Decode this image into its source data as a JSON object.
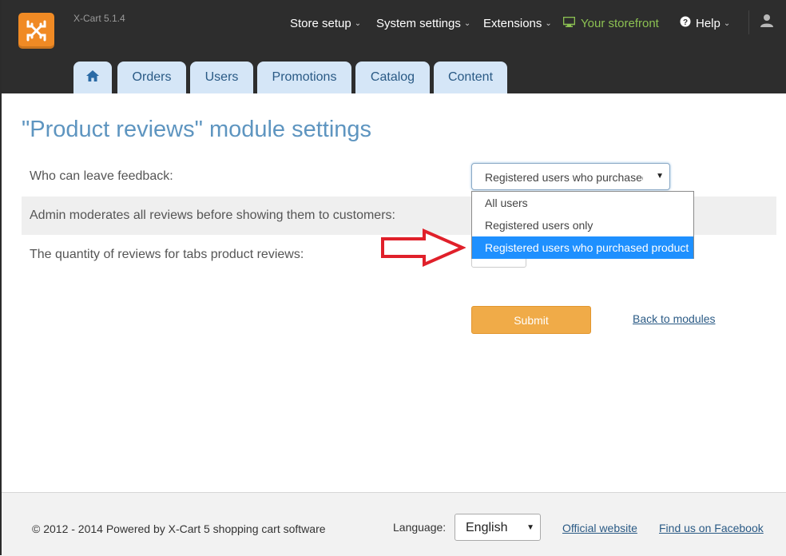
{
  "app": {
    "version": "X-Cart 5.1.4",
    "logo": "x-cart-logo"
  },
  "topnav": {
    "store_setup": "Store setup",
    "system_settings": "System settings",
    "extensions": "Extensions",
    "storefront": "Your storefront",
    "help": "Help"
  },
  "tabs": [
    "Orders",
    "Users",
    "Promotions",
    "Catalog",
    "Content"
  ],
  "page": {
    "title": "\"Product reviews\" module settings",
    "settings": [
      {
        "label": "Who can leave feedback:",
        "value": "Registered users who purchased product"
      },
      {
        "label": "Admin moderates all reviews before showing them to customers:"
      },
      {
        "label": "The quantity of reviews for tabs product reviews:"
      }
    ],
    "dropdown_options": [
      "All users",
      "Registered users only",
      "Registered users who purchased product"
    ],
    "selected_option_index": 2,
    "submit_label": "Submit",
    "back_link": "Back to modules"
  },
  "footer": {
    "copyright": "© 2012 - 2014 Powered by X-Cart 5 shopping cart software",
    "language_label": "Language:",
    "language_value": "English",
    "official_website": "Official website",
    "facebook": "Find us on Facebook"
  },
  "colors": {
    "header_bg": "#2d2d2d",
    "tab_bg": "#d5e6f7",
    "title": "#5e95c0",
    "storefront": "#8cc152",
    "submit": "#f0ab48",
    "selected_option": "#1e90ff",
    "arrow": "#e0202a"
  },
  "icons": [
    "home-icon",
    "monitor-icon",
    "help-circle-icon",
    "user-icon",
    "chevron-down-icon",
    "red-outline-arrow"
  ]
}
